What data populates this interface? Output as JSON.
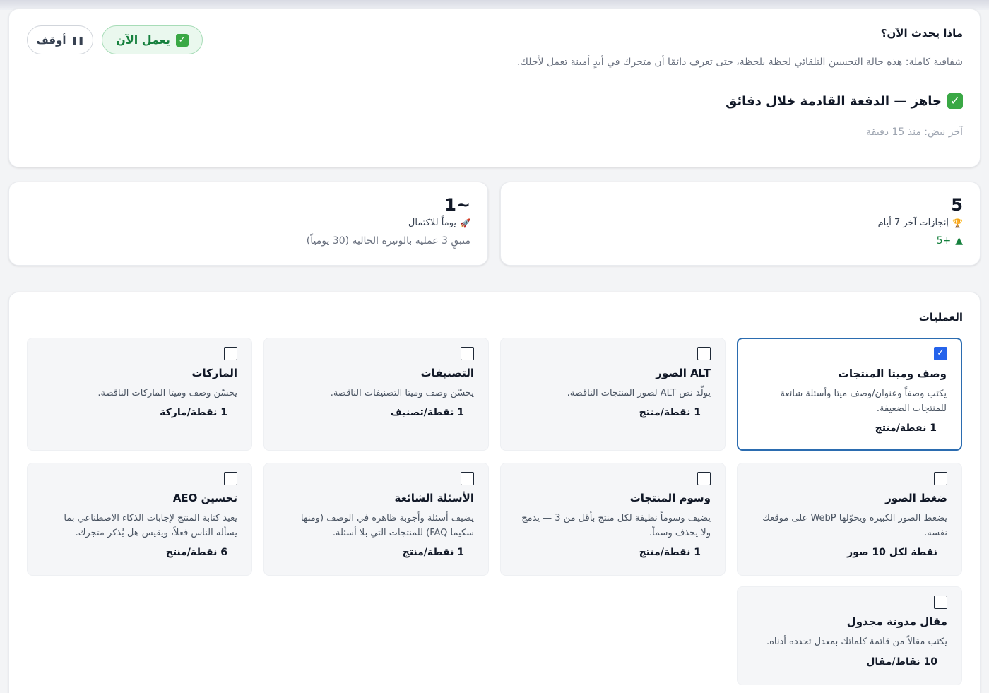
{
  "status": {
    "title": "ماذا يحدث الآن؟",
    "description": "شفافية كاملة: هذه حالة التحسين التلقائي لحظة بلحظة، حتى تعرف دائمًا أن متجرك في أيدٍ أمينة تعمل لأجلك.",
    "state_text": "جاهز — الدفعة القادمة خلال دقائق",
    "last_pulse": "آخر نبض: منذ 15 دقيقة",
    "running_label": "يعمل الآن",
    "pause_label": "أوقف"
  },
  "stats": {
    "achievements": {
      "value": "5",
      "label": "إنجازات آخر 7 أيام",
      "delta": "+5",
      "icon": "trophy-icon"
    },
    "completion": {
      "value": "~1",
      "label": "يوماً للاكتمال",
      "sub": "متبقٍ 3 عملية بالوتيرة الحالية (30 يومياً)",
      "icon": "rocket-icon"
    }
  },
  "operations": {
    "heading": "العمليات",
    "items": [
      {
        "name": "وصف وميتا المنتجات",
        "desc": "يكتب وصفاً وعنوان/وصف ميتا وأسئلة شائعة للمنتجات الضعيفة.",
        "cost": "1 نقطة/منتج",
        "checked": true
      },
      {
        "name": "ALT الصور",
        "desc": "يولّد نص ALT لصور المنتجات الناقصة.",
        "cost": "1 نقطة/منتج",
        "checked": false
      },
      {
        "name": "التصنيفات",
        "desc": "يحسّن وصف وميتا التصنيفات الناقصة.",
        "cost": "1 نقطة/تصنيف",
        "checked": false
      },
      {
        "name": "الماركات",
        "desc": "يحسّن وصف وميتا الماركات الناقصة.",
        "cost": "1 نقطة/ماركة",
        "checked": false
      },
      {
        "name": "ضغط الصور",
        "desc": "يضغط الصور الكبيرة ويحوّلها WebP على موقعك نفسه.",
        "cost": "نقطة لكل 10 صور",
        "checked": false
      },
      {
        "name": "وسوم المنتجات",
        "desc": "يضيف وسوماً نظيفة لكل منتج بأقل من 3 — يدمج ولا يحذف وسماً.",
        "cost": "1 نقطة/منتج",
        "checked": false
      },
      {
        "name": "الأسئلة الشائعة",
        "desc": "يضيف أسئلة وأجوبة ظاهرة في الوصف (ومنها سكيما FAQ) للمنتجات التي بلا أسئلة.",
        "cost": "1 نقطة/منتج",
        "checked": false
      },
      {
        "name": "تحسين AEO",
        "desc": "يعيد كتابة المنتج لإجابات الذكاء الاصطناعي بما يسأله الناس فعلاً، ويقيس هل يُذكر متجرك.",
        "cost": "6 نقطة/منتج",
        "checked": false
      },
      {
        "name": "مقال مدونة مجدول",
        "desc": "يكتب مقالاً من قائمة كلماتك بمعدل تحدده أدناه.",
        "cost": "10 نقاط/مقال",
        "checked": false
      }
    ]
  }
}
